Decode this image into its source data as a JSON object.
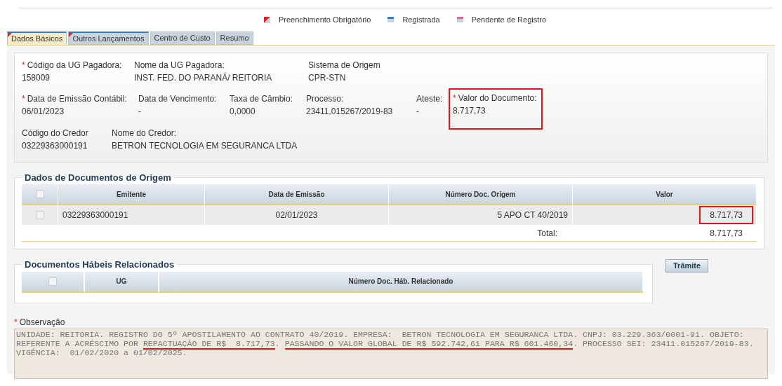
{
  "legend": [
    {
      "kind": "required",
      "label": "Preenchimento Obrigatório"
    },
    {
      "kind": "registered",
      "label": "Registrada"
    },
    {
      "kind": "pending",
      "label": "Pendente de Registro"
    }
  ],
  "tabs": [
    {
      "label": "Dados Básicos",
      "selected": true,
      "required": true,
      "registered": true
    },
    {
      "label": "Outros Lançamentos",
      "selected": false,
      "required": true,
      "registered": true
    },
    {
      "label": "Centro de Custo",
      "selected": false,
      "required": false,
      "registered": false
    },
    {
      "label": "Resumo",
      "selected": false,
      "required": false,
      "registered": false
    }
  ],
  "fields": [
    [
      {
        "mark": "*",
        "label": "Código da UG Pagadora:",
        "value": "158009",
        "highlighted": false
      },
      {
        "label": "Nome da UG Pagadora:",
        "value": "INST. FED. DO PARANÁ/ REITORIA",
        "highlighted": false
      },
      {
        "label": "Sistema de Origem",
        "value": "CPR-STN",
        "highlighted": false
      }
    ],
    [
      {
        "mark": "*",
        "label": "Data de Emissão Contábil:",
        "value": "06/01/2023",
        "highlighted": false
      },
      {
        "label": "Data de Vencimento:",
        "value": "-",
        "highlighted": false
      },
      {
        "label": "Taxa de Câmbio:",
        "value": "0,0000",
        "highlighted": false
      },
      {
        "label": "Processo:",
        "value": "23411.015267/2019-83",
        "highlighted": false
      },
      {
        "label": "Ateste:",
        "value": "-",
        "highlighted": false
      },
      {
        "mark": "*",
        "label": "Valor do Documento:",
        "value": "8.717,73",
        "highlighted": true
      }
    ],
    [
      {
        "label": "Código do Credor",
        "value": "03229363000191",
        "highlighted": false
      },
      {
        "label": "Nome do Credor:",
        "value": "BETRON TECNOLOGIA EM SEGURANCA LTDA",
        "highlighted": false
      }
    ]
  ],
  "origin_docs": {
    "title": "Dados de Documentos de Origem",
    "all_checked": false,
    "columns": [
      "Emitente",
      "Data de Emissão",
      "Número Doc. Origem",
      "Valor"
    ],
    "rows": [
      {
        "checked": false,
        "cells": [
          {
            "text": "03229363000191",
            "highlighted": false
          },
          {
            "text": "02/01/2023",
            "highlighted": false
          },
          {
            "text": "5 APO CT 40/2019",
            "highlighted": false
          },
          {
            "text": "8.717,73",
            "highlighted": true
          }
        ]
      }
    ],
    "total_label": "Total:",
    "total": "8.717,73"
  },
  "related_docs": {
    "title": "Documentos Hábeis Relacionados",
    "checked": false,
    "columns": [
      "UG",
      "Número Doc. Háb. Relacionado"
    ]
  },
  "tramite_button": "Trâmite",
  "observation": {
    "mark": "*",
    "label": "Observação",
    "segments": [
      {
        "text": "UNIDADE: REITORIA. REGISTRO DO 5º APOSTILAMENTO AO CONTRATO 40/2019. EMPRESA:  BETRON TECNOLOGIA EM SEGURANCA LTDA. CNPJ: 03.229.363/0001-91. OBJETO: REFERENTE A ACRÉSCIMO POR ",
        "underlined": false
      },
      {
        "text": "REPACTUAÇÃO DE R$  8.717,73",
        "underlined": true
      },
      {
        "text": ". ",
        "underlined": false
      },
      {
        "text": "PASSANDO O VALOR GLOBAL DE R$ 592.742,61 PARA R$ 601.460,34",
        "underlined": true
      },
      {
        "text": ". PROCESSO SEI: 23411.015267/2019-83. VIGÊNCIA:  01/02/2020 a 01/02/2025.",
        "underlined": false
      }
    ]
  }
}
